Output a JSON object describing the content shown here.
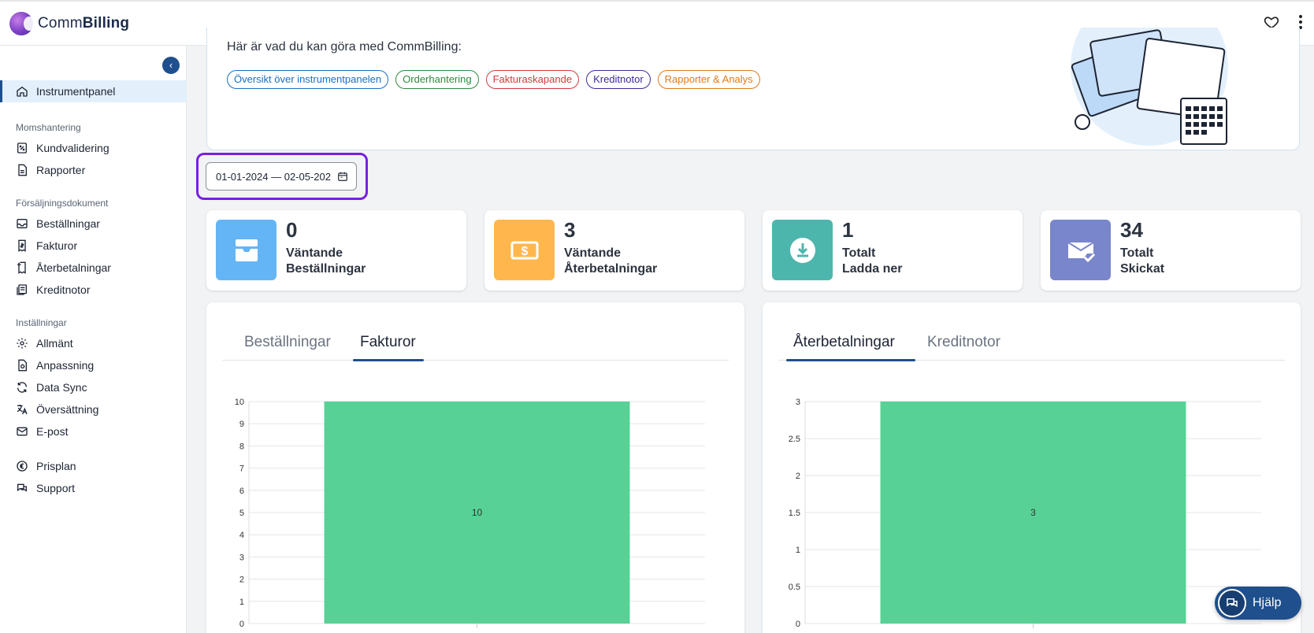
{
  "app": {
    "logo_prefix": "Comm",
    "logo_bold": "Billing"
  },
  "sidebar": {
    "active": {
      "label": "Instrumentpanel",
      "icon": "home-icon"
    },
    "sections": [
      {
        "title": "Momshantering",
        "items": [
          {
            "label": "Kundvalidering",
            "icon": "percent-badge-icon"
          },
          {
            "label": "Rapporter",
            "icon": "document-icon"
          }
        ]
      },
      {
        "title": "Försäljningsdokument",
        "items": [
          {
            "label": "Beställningar",
            "icon": "inbox-icon"
          },
          {
            "label": "Fakturor",
            "icon": "invoice-icon"
          },
          {
            "label": "Återbetalningar",
            "icon": "refund-icon"
          },
          {
            "label": "Kreditnotor",
            "icon": "credit-note-icon"
          }
        ]
      },
      {
        "title": "Inställningar",
        "items": [
          {
            "label": "Allmänt",
            "icon": "gear-icon"
          },
          {
            "label": "Anpassning",
            "icon": "customize-icon"
          },
          {
            "label": "Data Sync",
            "icon": "sync-icon"
          },
          {
            "label": "Översättning",
            "icon": "translate-icon"
          },
          {
            "label": "E-post",
            "icon": "mail-icon"
          }
        ]
      }
    ],
    "bottom": [
      {
        "label": "Prisplan",
        "icon": "euro-icon"
      },
      {
        "label": "Support",
        "icon": "chat-icon"
      }
    ]
  },
  "hero": {
    "title": "Här är vad du kan göra med CommBilling:",
    "chips": [
      {
        "label": "Översikt över instrumentpanelen",
        "color": "#1a6fc4"
      },
      {
        "label": "Orderhantering",
        "color": "#2e8a3e"
      },
      {
        "label": "Fakturaskapande",
        "color": "#d13b3b"
      },
      {
        "label": "Kreditnotor",
        "color": "#3d2a9a"
      },
      {
        "label": "Rapporter & Analys",
        "color": "#e07a1a"
      }
    ]
  },
  "date_range": {
    "value": "01-01-2024 — 02-05-202"
  },
  "stats": [
    {
      "value": "0",
      "line1": "Väntande",
      "line2": "Beställningar",
      "color": "#64b5f6",
      "icon": "inbox-tray-icon"
    },
    {
      "value": "3",
      "line1": "Väntande",
      "line2": "Återbetalningar",
      "color": "#ffb74d",
      "icon": "money-icon"
    },
    {
      "value": "1",
      "line1": "Totalt",
      "line2": "Ladda ner",
      "color": "#4db6ac",
      "icon": "download-icon"
    },
    {
      "value": "34",
      "line1": "Totalt",
      "line2": "Skickat",
      "color": "#7986cb",
      "icon": "mail-check-icon"
    }
  ],
  "panels": [
    {
      "tabs": [
        "Beställningar",
        "Fakturor"
      ],
      "active_tab": 1
    },
    {
      "tabs": [
        "Återbetalningar",
        "Kreditnotor"
      ],
      "active_tab": 0
    }
  ],
  "help": {
    "label": "Hjälp"
  },
  "chart_data": [
    {
      "type": "bar",
      "categories": [
        ""
      ],
      "values": [
        10
      ],
      "ylim": [
        0,
        10
      ],
      "yticks": [
        "0",
        "1",
        "2",
        "3",
        "4",
        "5",
        "6",
        "7",
        "8",
        "9",
        "10"
      ],
      "data_label": "10",
      "bar_color": "#57d195"
    },
    {
      "type": "bar",
      "categories": [
        ""
      ],
      "values": [
        3
      ],
      "ylim": [
        0,
        3
      ],
      "yticks": [
        "0",
        "0.5",
        "1",
        "1.5",
        "2",
        "2.5",
        "3"
      ],
      "data_label": "3",
      "bar_color": "#57d195"
    }
  ]
}
